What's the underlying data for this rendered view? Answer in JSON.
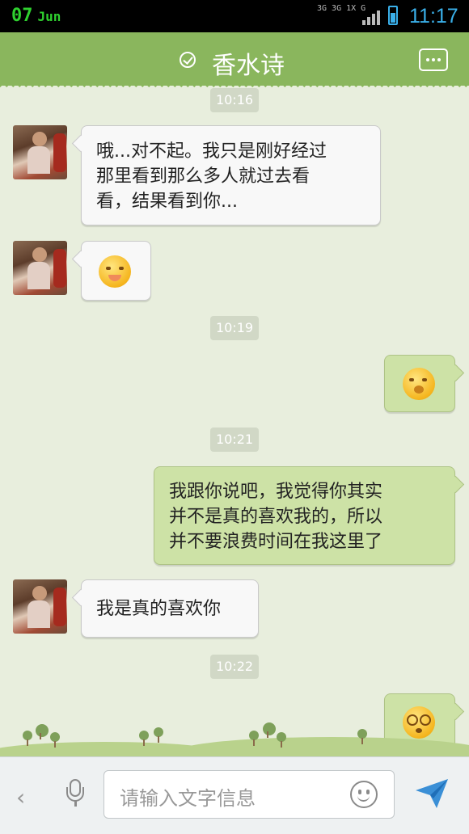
{
  "status_bar": {
    "day": "07",
    "month": "Jun",
    "network": "3G 3G 1X G",
    "time": "11:17"
  },
  "header": {
    "title": "香水诗",
    "verified_icon": "check-circle-icon",
    "more_icon": "more-dots-icon"
  },
  "colors": {
    "header": "#8ab65d",
    "chat_background": "#e8eedd",
    "outgoing_bubble": "#cde2a6",
    "incoming_bubble": "#f8f8f8",
    "timestamp_bg": "#d1d8c6",
    "send_accent": "#3a8fd6"
  },
  "chat": {
    "timestamps": [
      "10:16",
      "10:19",
      "10:21",
      "10:22"
    ],
    "messages": [
      {
        "direction": "incoming",
        "type": "text",
        "text_lines": [
          "哦...对不起。我只是刚好经过",
          "那里看到那么多人就过去看",
          "看，结果看到你..."
        ]
      },
      {
        "direction": "incoming",
        "type": "emoji",
        "emoji": "shy-face-emoji"
      },
      {
        "direction": "outgoing",
        "type": "emoji",
        "emoji": "thinking-face-emoji"
      },
      {
        "direction": "outgoing",
        "type": "text",
        "text_lines": [
          "我跟你说吧，我觉得你其实",
          "并不是真的喜欢我的，所以",
          "并不要浪费时间在我这里了"
        ]
      },
      {
        "direction": "incoming",
        "type": "text",
        "text_lines": [
          "我是真的喜欢你"
        ]
      },
      {
        "direction": "outgoing",
        "type": "emoji",
        "emoji": "dizzy-face-emoji"
      }
    ]
  },
  "input_bar": {
    "placeholder": "请输入文字信息",
    "back_icon": "chevron-left-icon",
    "mic_icon": "microphone-icon",
    "emoji_icon": "smiley-icon",
    "send_icon": "send-icon"
  }
}
